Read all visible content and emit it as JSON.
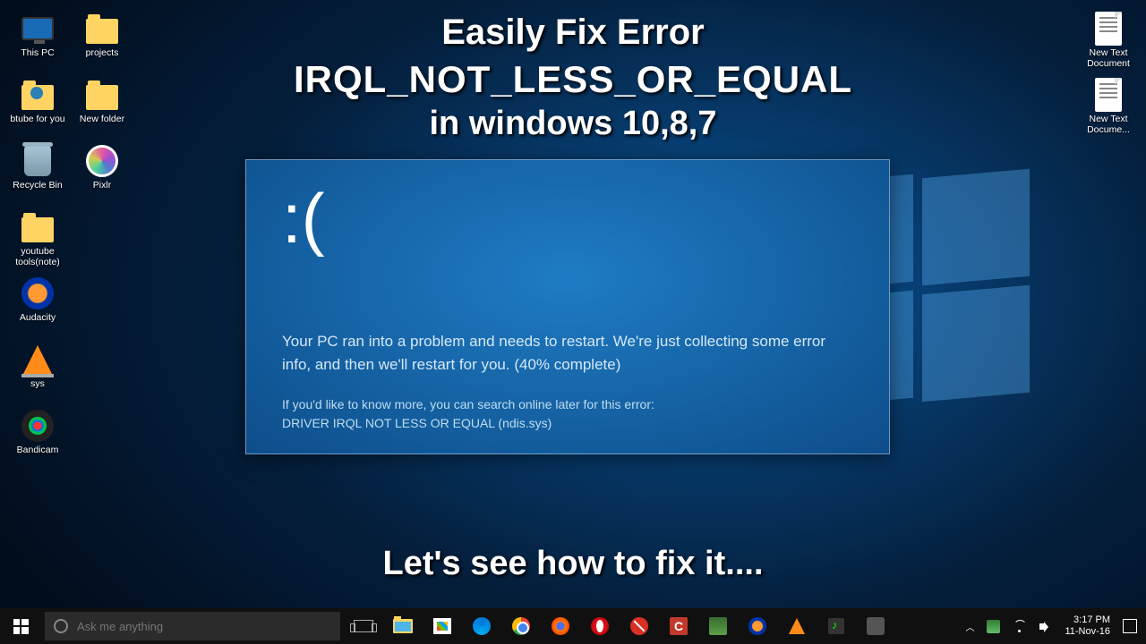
{
  "overlay": {
    "line1": "Easily Fix Error",
    "line2": "IRQL_NOT_LESS_OR_EQUAL",
    "line3": "in windows 10,8,7",
    "footer": "Let's see how to fix it...."
  },
  "bsod": {
    "face": ":(",
    "message": "Your PC ran into a problem and needs to restart. We're just collecting some error info, and then we'll restart for you. (40% complete)",
    "sub1": "If you'd like to know more, you can search online later for this error:",
    "sub2": "DRIVER IRQL NOT LESS OR EQUAL (ndis.sys)"
  },
  "desktop_left": [
    [
      {
        "label": "This PC",
        "kind": "monitor"
      },
      {
        "label": "projects",
        "kind": "folder"
      }
    ],
    [
      {
        "label": "btube for you",
        "kind": "folder-user"
      },
      {
        "label": "New folder",
        "kind": "folder"
      }
    ],
    [
      {
        "label": "Recycle Bin",
        "kind": "recycle"
      },
      {
        "label": "Pixlr",
        "kind": "pixlr"
      }
    ],
    [
      {
        "label": "youtube tools(note)",
        "kind": "folder"
      }
    ],
    [
      {
        "label": "Audacity",
        "kind": "audacity"
      }
    ],
    [
      {
        "label": "sys",
        "kind": "vlc"
      }
    ],
    [
      {
        "label": "Bandicam",
        "kind": "bandicam"
      }
    ]
  ],
  "desktop_right": [
    {
      "label": "New Text Document",
      "kind": "txt"
    },
    {
      "label": "New Text Docume...",
      "kind": "txt"
    }
  ],
  "taskbar": {
    "search_placeholder": "Ask me anything",
    "pinned": [
      "taskview",
      "explorer",
      "store",
      "edge",
      "chrome",
      "firefox",
      "opera",
      "block",
      "ccleaner",
      "idm",
      "audacity",
      "vlc",
      "music",
      "generic"
    ],
    "time": "3:17 PM",
    "date": "11-Nov-16"
  }
}
